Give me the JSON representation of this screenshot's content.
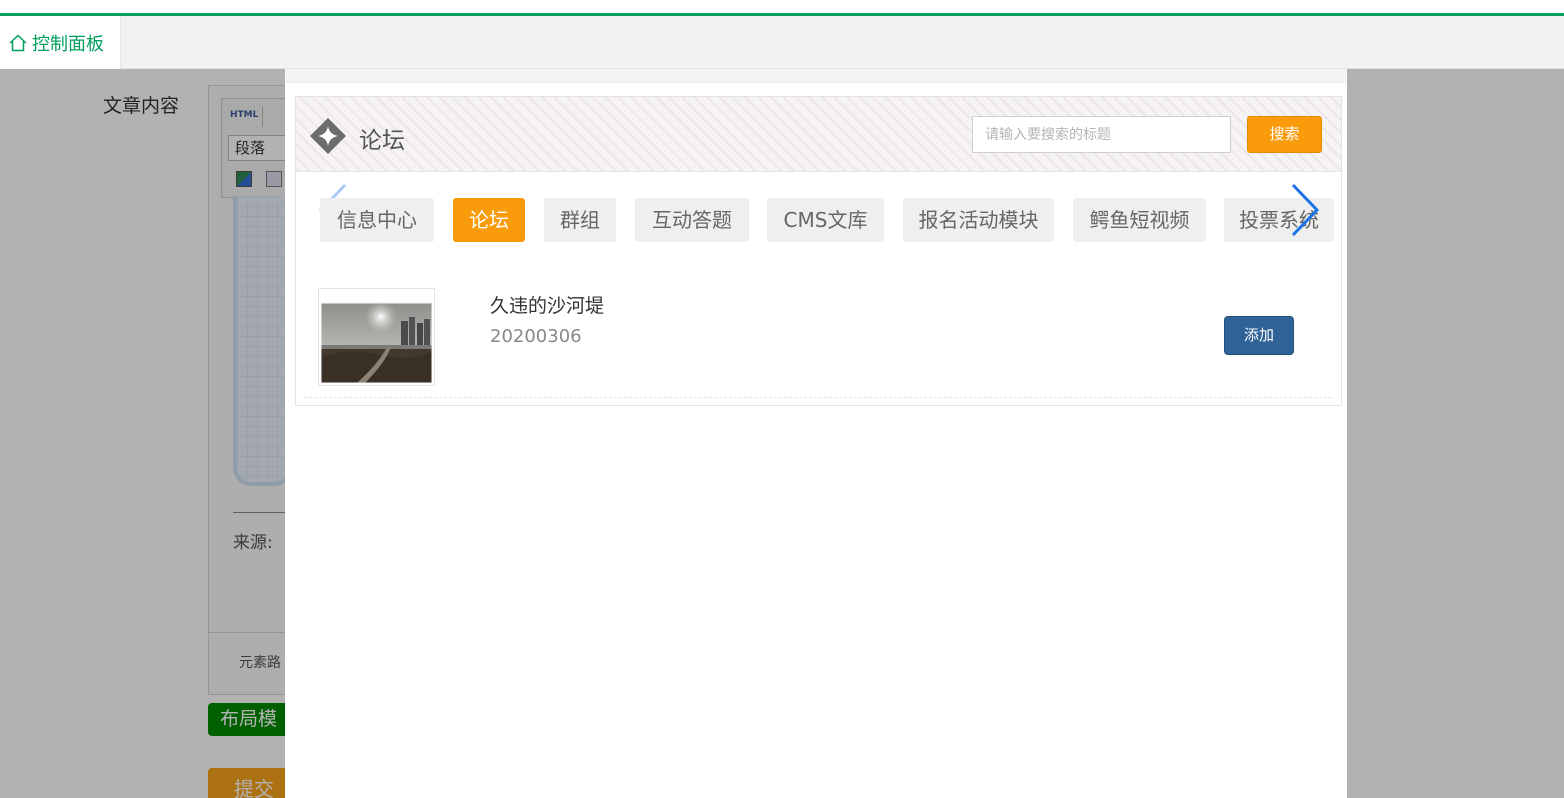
{
  "header": {
    "tab_label": "控制面板",
    "tab_icon": "home-icon",
    "accent_color": "#009f5d"
  },
  "background_page": {
    "article_label": "文章内容",
    "editor": {
      "html_label": "HTML",
      "paragraph_select": "段落",
      "source_label": "来源:",
      "path_label": "元素路"
    },
    "layout_button": "布局模",
    "submit_button": "提交"
  },
  "modal": {
    "title": "论坛",
    "title_icon": "sparkle-icon",
    "search": {
      "placeholder": "请输入要搜索的标题",
      "button_label": "搜索"
    },
    "categories": [
      {
        "label": "信息中心",
        "active": false
      },
      {
        "label": "论坛",
        "active": true
      },
      {
        "label": "群组",
        "active": false
      },
      {
        "label": "互动答题",
        "active": false
      },
      {
        "label": "CMS文库",
        "active": false
      },
      {
        "label": "报名活动模块",
        "active": false
      },
      {
        "label": "鳄鱼短视频",
        "active": false
      },
      {
        "label": "投票系统",
        "active": false
      }
    ],
    "items": [
      {
        "title": "久违的沙河堤",
        "date": "20200306",
        "add_label": "添加"
      }
    ],
    "accent_color": "#f99b0b",
    "add_button_color": "#2f6296"
  }
}
